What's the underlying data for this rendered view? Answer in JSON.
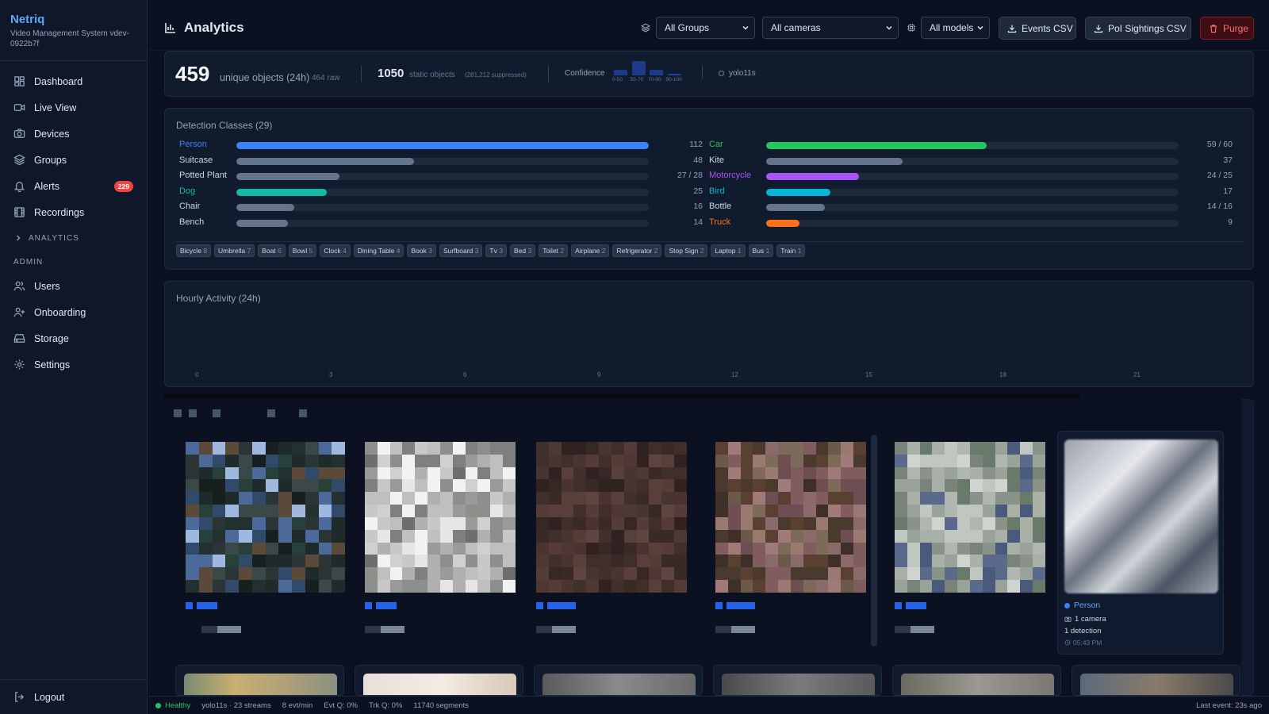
{
  "app": {
    "name": "Netriq",
    "subtitle": "Video Management System vdev-0922b7f"
  },
  "nav": {
    "items": [
      {
        "label": "Dashboard",
        "icon": "grid-icon"
      },
      {
        "label": "Live View",
        "icon": "video-icon"
      },
      {
        "label": "Devices",
        "icon": "camera-icon"
      },
      {
        "label": "Groups",
        "icon": "layers-icon"
      },
      {
        "label": "Alerts",
        "icon": "bell-icon",
        "badge": "229"
      },
      {
        "label": "Recordings",
        "icon": "film-icon"
      }
    ],
    "analytics_label": "ANALYTICS",
    "admin_label": "ADMIN",
    "admin_items": [
      {
        "label": "Users",
        "icon": "users-icon"
      },
      {
        "label": "Onboarding",
        "icon": "user-plus-icon"
      },
      {
        "label": "Storage",
        "icon": "hard-drive-icon"
      },
      {
        "label": "Settings",
        "icon": "gear-icon"
      }
    ],
    "logout": "Logout"
  },
  "header": {
    "title": "Analytics",
    "groups_select": "All Groups",
    "cameras_select": "All cameras",
    "models_select": "All models",
    "events_csv": "Events CSV",
    "poi_csv": "PoI Sightings CSV",
    "purge": "Purge"
  },
  "summary": {
    "unique_count": "459",
    "unique_label": "unique objects (24h)",
    "raw": "464 raw",
    "static_count": "1050",
    "static_label": "static objects",
    "suppressed": "(281,212 suppressed)",
    "confidence_label": "Confidence",
    "confidence_bins": [
      {
        "label": "0-50",
        "value": 0.3
      },
      {
        "label": "50-70",
        "value": 0.75
      },
      {
        "label": "70-90",
        "value": 0.3
      },
      {
        "label": "90-100",
        "value": 0.08
      }
    ],
    "model": "yolo11s"
  },
  "classes": {
    "title": "Detection Classes (29)",
    "left": [
      {
        "name": "Person",
        "count": "112",
        "ratio": 1.0,
        "color": "#3b82f6",
        "highlight": true
      },
      {
        "name": "Suitcase",
        "count": "48",
        "ratio": 0.43,
        "color": "#64748b",
        "highlight": false
      },
      {
        "name": "Potted Plant",
        "count": "27 / 28",
        "ratio": 0.25,
        "color": "#64748b",
        "highlight": false
      },
      {
        "name": "Dog",
        "count": "25",
        "ratio": 0.22,
        "color": "#14b8a6",
        "highlight": true
      },
      {
        "name": "Chair",
        "count": "16",
        "ratio": 0.14,
        "color": "#64748b",
        "highlight": false
      },
      {
        "name": "Bench",
        "count": "14",
        "ratio": 0.125,
        "color": "#64748b",
        "highlight": false
      }
    ],
    "right": [
      {
        "name": "Car",
        "count": "59 / 60",
        "ratio": 0.535,
        "color": "#22c55e",
        "highlight": true
      },
      {
        "name": "Kite",
        "count": "37",
        "ratio": 0.33,
        "color": "#64748b",
        "highlight": false
      },
      {
        "name": "Motorcycle",
        "count": "24 / 25",
        "ratio": 0.225,
        "color": "#a855f7",
        "highlight": true
      },
      {
        "name": "Bird",
        "count": "17",
        "ratio": 0.155,
        "color": "#06b6d4",
        "highlight": true
      },
      {
        "name": "Bottle",
        "count": "14 / 16",
        "ratio": 0.143,
        "color": "#64748b",
        "highlight": false
      },
      {
        "name": "Truck",
        "count": "9",
        "ratio": 0.08,
        "color": "#f97316",
        "highlight": true
      }
    ],
    "chips": [
      {
        "name": "Bicycle",
        "count": "8"
      },
      {
        "name": "Umbrella",
        "count": "7"
      },
      {
        "name": "Boat",
        "count": "6"
      },
      {
        "name": "Bowl",
        "count": "5"
      },
      {
        "name": "Clock",
        "count": "4"
      },
      {
        "name": "Dining Table",
        "count": "4"
      },
      {
        "name": "Book",
        "count": "3"
      },
      {
        "name": "Surfboard",
        "count": "3"
      },
      {
        "name": "Tv",
        "count": "3"
      },
      {
        "name": "Bed",
        "count": "3"
      },
      {
        "name": "Toilet",
        "count": "2"
      },
      {
        "name": "Airplane",
        "count": "2"
      },
      {
        "name": "Refrigerator",
        "count": "2"
      },
      {
        "name": "Stop Sign",
        "count": "2"
      },
      {
        "name": "Laptop",
        "count": "1"
      },
      {
        "name": "Bus",
        "count": "1"
      },
      {
        "name": "Train",
        "count": "1"
      }
    ]
  },
  "hourly": {
    "title": "Hourly Activity (24h)",
    "ticks": [
      "0",
      "3",
      "6",
      "9",
      "12",
      "15",
      "18",
      "21"
    ]
  },
  "sighting": {
    "class": "Person",
    "cameras": "1 camera",
    "detections": "1 detection",
    "time": "05:43 PM"
  },
  "status": {
    "health": "Healthy",
    "model_streams": "yolo11s · 23 streams",
    "rate": "8 evt/min",
    "evt_q": "Evt Q: 0%",
    "trk_q": "Trk Q: 0%",
    "segments": "11740 segments",
    "last_event": "Last event: 23s ago"
  }
}
